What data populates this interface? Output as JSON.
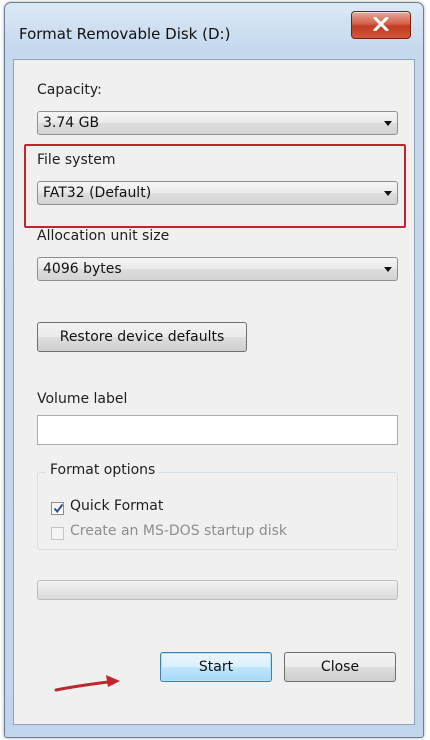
{
  "window": {
    "title": "Format Removable Disk (D:)"
  },
  "capacity": {
    "label": "Capacity:",
    "value": "3.74 GB"
  },
  "file_system": {
    "label": "File system",
    "value": "FAT32 (Default)"
  },
  "allocation": {
    "label": "Allocation unit size",
    "value": "4096 bytes"
  },
  "restore_button": {
    "label": "Restore device defaults"
  },
  "volume_label": {
    "label": "Volume label",
    "value": ""
  },
  "format_options": {
    "title": "Format options",
    "quick_format": {
      "label": "Quick Format",
      "checked": true
    },
    "msdos": {
      "label": "Create an MS-DOS startup disk",
      "checked": false,
      "enabled": false
    }
  },
  "progress": {
    "fraction": 0
  },
  "buttons": {
    "start": "Start",
    "close": "Close"
  },
  "colors": {
    "highlight": "#c0272d",
    "annotation_arrow": "#c0272d",
    "close_button": "#c84a30"
  },
  "icons": {
    "title_close": "close-x-icon",
    "dropdown": "chevron-down-icon",
    "checkmark": "checkmark-icon",
    "annotation": "red-arrow"
  }
}
